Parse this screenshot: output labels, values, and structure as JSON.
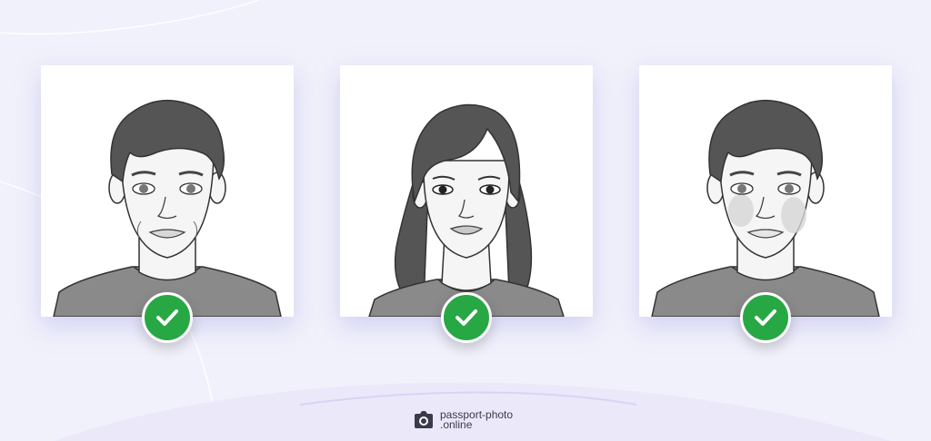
{
  "page": {
    "background": "#f1f1fb",
    "accent_check": "#28a745"
  },
  "portraits": [
    {
      "subject": "man",
      "status": "accepted",
      "badge_icon": "checkmark-icon"
    },
    {
      "subject": "woman",
      "status": "accepted",
      "badge_icon": "checkmark-icon"
    },
    {
      "subject": "man-with-shadows",
      "status": "accepted",
      "badge_icon": "checkmark-icon"
    }
  ],
  "logo": {
    "icon": "camera-icon",
    "line1": "passport-photo",
    "line2": ".online"
  }
}
